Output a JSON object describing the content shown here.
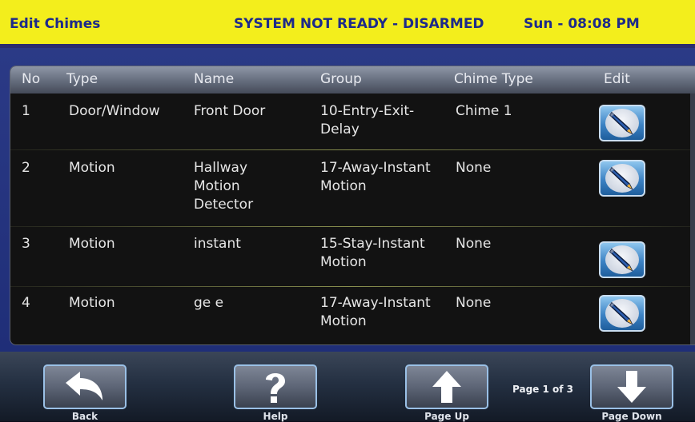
{
  "header": {
    "title": "Edit Chimes",
    "status": "SYSTEM NOT READY - DISARMED",
    "clock": "Sun - 08:08 PM"
  },
  "table": {
    "columns": [
      "No",
      "Type",
      "Name",
      "Group",
      "Chime Type",
      "Edit"
    ],
    "rows": [
      {
        "no": "1",
        "type": "Door/Window",
        "name": "Front Door",
        "group": "10-Entry-Exit-Delay",
        "chime": "Chime 1"
      },
      {
        "no": "2",
        "type": "Motion",
        "name": "Hallway Motion Detector",
        "group": "17-Away-Instant Motion",
        "chime": "None"
      },
      {
        "no": "3",
        "type": "Motion",
        "name": "instant",
        "group": "15-Stay-Instant Motion",
        "chime": "None"
      },
      {
        "no": "4",
        "type": "Motion",
        "name": "ge e",
        "group": "17-Away-Instant Motion",
        "chime": "None"
      }
    ]
  },
  "footer": {
    "back": "Back",
    "help": "Help",
    "page_up": "Page Up",
    "page_down": "Page Down",
    "page_info": "Page 1 of 3"
  },
  "icons": {
    "edit": "pencil-edit-icon",
    "back": "back-arrow-icon",
    "help": "question-mark-icon",
    "page_up": "up-arrow-icon",
    "page_down": "down-arrow-icon"
  },
  "colors": {
    "header_bg": "#f3ee1c",
    "header_text": "#1d2a8a",
    "main_bg": "#2b3a86",
    "panel_bg": "#121212"
  }
}
